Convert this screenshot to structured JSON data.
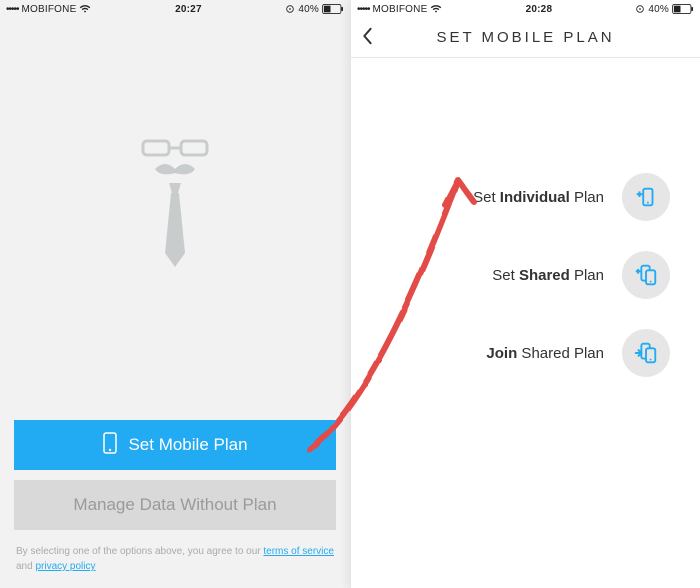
{
  "left": {
    "statusbar": {
      "signal": "•••••",
      "carrier": "MOBIFONE",
      "time": "20:27",
      "battery_pct": "40%"
    },
    "primary_button": "Set Mobile Plan",
    "secondary_button": "Manage Data Without Plan",
    "legal_pre": "By selecting one of the options above, you agree to our ",
    "legal_terms": "terms of service",
    "legal_mid": " and ",
    "legal_privacy": "privacy policy"
  },
  "right": {
    "statusbar": {
      "signal": "•••••",
      "carrier": "MOBIFONE",
      "time": "20:28",
      "battery_pct": "40%"
    },
    "nav_title": "SET MOBILE PLAN",
    "options": [
      {
        "pre": "Set ",
        "bold": "Individual",
        "post": " Plan",
        "icon": "individual"
      },
      {
        "pre": "Set ",
        "bold": "Shared",
        "post": " Plan",
        "icon": "shared"
      },
      {
        "pre": "",
        "bold": "Join",
        "post": " Shared Plan",
        "icon": "join"
      }
    ]
  }
}
